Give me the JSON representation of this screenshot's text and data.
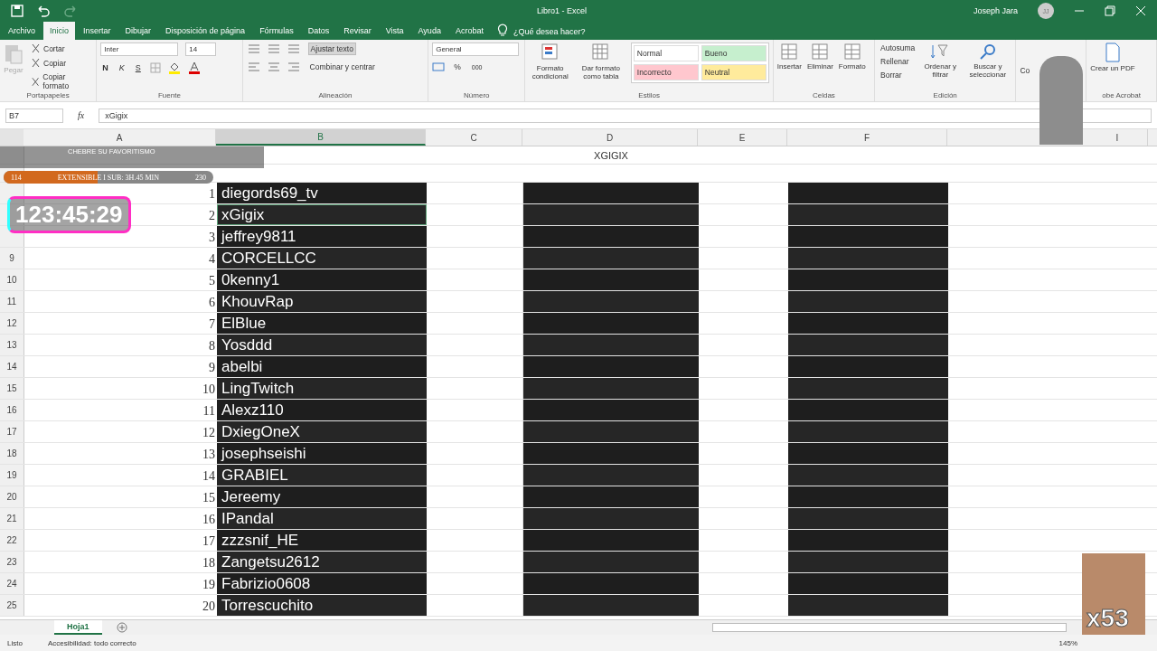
{
  "title_bar": {
    "title": "Libro1 - Excel",
    "user": "Joseph Jara",
    "initials": "JJ"
  },
  "ribbon_tabs": [
    {
      "label": "Archivo",
      "selected": false
    },
    {
      "label": "Inicio",
      "selected": true
    },
    {
      "label": "Insertar",
      "selected": false
    },
    {
      "label": "Dibujar",
      "selected": false
    },
    {
      "label": "Disposición de página",
      "selected": false
    },
    {
      "label": "Fórmulas",
      "selected": false
    },
    {
      "label": "Datos",
      "selected": false
    },
    {
      "label": "Revisar",
      "selected": false
    },
    {
      "label": "Vista",
      "selected": false
    },
    {
      "label": "Ayuda",
      "selected": false
    },
    {
      "label": "Acrobat",
      "selected": false
    }
  ],
  "tell_me": "¿Qué desea hacer?",
  "clipboard": {
    "label": "Portapapeles",
    "paste": "Pegar",
    "paste_disabled": true,
    "items": [
      "Cortar",
      "Copiar",
      "Copiar formato"
    ]
  },
  "font": {
    "label": "Fuente",
    "family": "Inter",
    "size": "14",
    "bold": "N",
    "italic": "K",
    "underline": "S"
  },
  "alignment": {
    "label": "Alineación",
    "wrap": "Ajustar texto",
    "wrap_on": true,
    "merge": "Combinar y centrar"
  },
  "number": {
    "label": "Número",
    "format": "General",
    "percent": "%",
    "thousands": "000"
  },
  "styles": {
    "label": "Estilos",
    "conditional": "Formato condicional",
    "as_table": "Dar formato como tabla",
    "cells": [
      {
        "label": "Normal",
        "color": "#ffffff"
      },
      {
        "label": "Bueno",
        "color": "#c6efce"
      },
      {
        "label": "Incorrecto",
        "color": "#ffc7ce"
      },
      {
        "label": "Neutral",
        "color": "#ffeb9c"
      }
    ]
  },
  "cells_group": {
    "label": "Celdas",
    "buttons": [
      "Insertar",
      "Eliminar",
      "Formato"
    ]
  },
  "editing": {
    "label": "Edición",
    "items": [
      "Autosuma",
      "Rellenar",
      "Borrar"
    ],
    "sort": "Ordenar y filtrar",
    "find": "Buscar y seleccionar"
  },
  "addins": {
    "label": "Co"
  },
  "acrobat": {
    "button": "Crear un PDF",
    "label": "obe Acrobat"
  },
  "formula_bar": {
    "name_box": "B7",
    "fx": "fx",
    "formula": "xGigix"
  },
  "columns": [
    {
      "letter": "A",
      "selected": false
    },
    {
      "letter": "B",
      "selected": true
    },
    {
      "letter": "C",
      "selected": false
    },
    {
      "letter": "D",
      "selected": false
    },
    {
      "letter": "E",
      "selected": false
    },
    {
      "letter": "F",
      "selected": false
    },
    {
      "letter": "I",
      "selected": false
    }
  ],
  "header_cell": "XGIGIX",
  "rows": [
    {
      "index": "1",
      "name": "diegords69_tv",
      "selected": false
    },
    {
      "index": "2",
      "name": "xGigix",
      "selected": true
    },
    {
      "index": "3",
      "name": "jeffrey9811",
      "selected": false
    },
    {
      "row": "9",
      "index": "4",
      "name": "CORCELLCC",
      "selected": false
    },
    {
      "row": "10",
      "index": "5",
      "name": "0kenny1",
      "selected": false
    },
    {
      "row": "11",
      "index": "6",
      "name": "KhouvRap",
      "selected": false
    },
    {
      "row": "12",
      "index": "7",
      "name": "ElBlue",
      "selected": false
    },
    {
      "row": "13",
      "index": "8",
      "name": "Yosddd",
      "selected": false
    },
    {
      "row": "14",
      "index": "9",
      "name": "abelbi",
      "selected": false
    },
    {
      "row": "15",
      "index": "10",
      "name": "LingTwitch",
      "selected": false
    },
    {
      "row": "16",
      "index": "11",
      "name": "Alexz110",
      "selected": false
    },
    {
      "row": "17",
      "index": "12",
      "name": "DxiegOneX",
      "selected": false
    },
    {
      "row": "18",
      "index": "13",
      "name": "josephseishi",
      "selected": false
    },
    {
      "row": "19",
      "index": "14",
      "name": "GRABIEL",
      "selected": false
    },
    {
      "row": "20",
      "index": "15",
      "name": "Jereemy",
      "selected": false
    },
    {
      "row": "21",
      "index": "16",
      "name": "IPandal",
      "selected": false
    },
    {
      "row": "22",
      "index": "17",
      "name": "zzzsnif_HE",
      "selected": false
    },
    {
      "row": "23",
      "index": "18",
      "name": "Zangetsu2612",
      "selected": false
    },
    {
      "row": "24",
      "index": "19",
      "name": "Fabrizio0608",
      "selected": false
    },
    {
      "row": "25",
      "index": "20",
      "name": "Torrescuchito",
      "selected": false
    }
  ],
  "overlay": {
    "chat": [
      "CHEBRE SU FAVORITISMO"
    ],
    "goal_start": "114",
    "goal_text": "EXTENSIBLE I SUB: 3H.45 MIN",
    "goal_end": "230",
    "level": 0.45,
    "timer": "123:45:29",
    "counter": "x53"
  },
  "sheet_tabs": [
    {
      "label": "Hoja1",
      "selected": true
    }
  ],
  "status_bar": {
    "ready": "Listo",
    "accessibility": "Accesibilidad: todo correcto",
    "zoom": "145%"
  }
}
